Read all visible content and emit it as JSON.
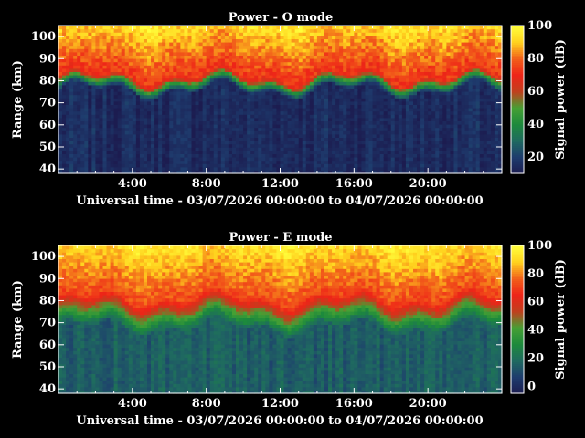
{
  "chart_data": [
    {
      "type": "heatmap",
      "title": "Power - O mode",
      "xlabel": "Universal time - 03/07/2026 00:00:00 to 04/07/2026 00:00:00",
      "ylabel": "Range (km)",
      "x_unit": "hours UT",
      "xlim": [
        0,
        24
      ],
      "ylim": [
        38,
        105
      ],
      "x_ticks": [
        4,
        8,
        12,
        16,
        20
      ],
      "x_tick_labels": [
        "4:00",
        "8:00",
        "12:00",
        "16:00",
        "20:00"
      ],
      "y_ticks": [
        40,
        50,
        60,
        70,
        80,
        90,
        100
      ],
      "y_tick_labels": [
        "40",
        "50",
        "60",
        "70",
        "80",
        "90",
        "100"
      ],
      "colorbar": {
        "label": "Signal power (dB)",
        "range": [
          10,
          100
        ],
        "ticks": [
          20,
          40,
          60,
          80,
          100
        ],
        "tick_labels": [
          "20",
          "40",
          "60",
          "80",
          "100"
        ]
      },
      "profile_approx": {
        "noise_floor_db": 12,
        "rise_range_km": [
          76,
          82
        ],
        "above_echo_db": 70
      }
    },
    {
      "type": "heatmap",
      "title": "Power - E mode",
      "xlabel": "Universal time - 03/07/2026 00:00:00 to 04/07/2026 00:00:00",
      "ylabel": "Range (km)",
      "x_unit": "hours UT",
      "xlim": [
        0,
        24
      ],
      "ylim": [
        38,
        105
      ],
      "x_ticks": [
        4,
        8,
        12,
        16,
        20
      ],
      "x_tick_labels": [
        "4:00",
        "8:00",
        "12:00",
        "16:00",
        "20:00"
      ],
      "y_ticks": [
        40,
        50,
        60,
        70,
        80,
        90,
        100
      ],
      "y_tick_labels": [
        "40",
        "50",
        "60",
        "70",
        "80",
        "90",
        "100"
      ],
      "colorbar": {
        "label": "Signal power (dB)",
        "range": [
          -5,
          100
        ],
        "ticks": [
          0,
          20,
          40,
          60,
          80,
          100
        ],
        "tick_labels": [
          "0",
          "20",
          "40",
          "60",
          "80",
          "100"
        ]
      },
      "profile_approx": {
        "noise_floor_db": 12,
        "rise_range_km": [
          68,
          82
        ],
        "above_echo_db": 70
      }
    }
  ],
  "colors": {
    "background": "#000000",
    "text": "#ffffff",
    "colormap": [
      "#1c1c50",
      "#1e3c6e",
      "#1f6a60",
      "#1d8a3c",
      "#46a034",
      "#c0401e",
      "#ee2418",
      "#f2601a",
      "#ffd21e",
      "#ffff3c"
    ]
  }
}
